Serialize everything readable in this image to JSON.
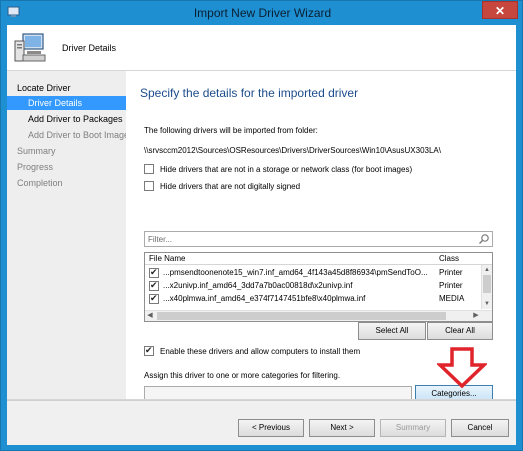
{
  "window": {
    "title": "Import New Driver Wizard",
    "close_label": "✕"
  },
  "header": {
    "title": "Driver Details"
  },
  "nav": {
    "items": [
      {
        "label": "Locate Driver",
        "level": 1,
        "state": "active"
      },
      {
        "label": "Driver Details",
        "level": 2,
        "state": "selected"
      },
      {
        "label": "Add Driver to Packages",
        "level": 2,
        "state": "active"
      },
      {
        "label": "Add Driver to Boot Images",
        "level": 2,
        "state": "dim"
      },
      {
        "label": "Summary",
        "level": 1,
        "state": "dim"
      },
      {
        "label": "Progress",
        "level": 1,
        "state": "dim"
      },
      {
        "label": "Completion",
        "level": 1,
        "state": "dim"
      }
    ]
  },
  "main": {
    "heading": "Specify the details for the imported driver",
    "folder_label": "The following drivers will be imported from folder:",
    "folder_path": "\\\\srvsccm2012\\Sources\\OSResources\\Drivers\\DriverSources\\Win10\\AsusUX303LA\\",
    "hide_not_storage_label": "Hide drivers that are not in a storage or network class (for boot images)",
    "hide_not_storage_checked": false,
    "hide_unsigned_label": "Hide drivers that are not digitally signed",
    "hide_unsigned_checked": false,
    "filter_placeholder": "Filter...",
    "grid": {
      "columns": [
        "File Name",
        "Class"
      ],
      "rows": [
        {
          "checked": true,
          "name": "...pmsendtoonenote15_win7.inf_amd64_4f143a45d8f86934\\pmSendToO...",
          "class": "Printer"
        },
        {
          "checked": true,
          "name": "...x2univp.inf_amd64_3dd7a7b0ac00818d\\x2univp.inf",
          "class": "Printer"
        },
        {
          "checked": true,
          "name": "...x40plmwa.inf_amd64_e374f7147451bfe8\\x40plmwa.inf",
          "class": "MEDIA"
        }
      ]
    },
    "select_all_label": "Select All",
    "clear_all_label": "Clear All",
    "enable_label": "Enable these drivers and allow computers to install them",
    "enable_checked": true,
    "assign_label": "Assign this driver to one or more categories for filtering.",
    "assign_value": "",
    "categories_label": "Categories...",
    "arrow_color": "#e0242b"
  },
  "footer": {
    "previous_label": "< Previous",
    "next_label": "Next >",
    "summary_label": "Summary",
    "cancel_label": "Cancel"
  },
  "colors": {
    "frame": "#1e8fd0",
    "selected_nav": "#3399ff",
    "heading": "#1c4c8c"
  }
}
